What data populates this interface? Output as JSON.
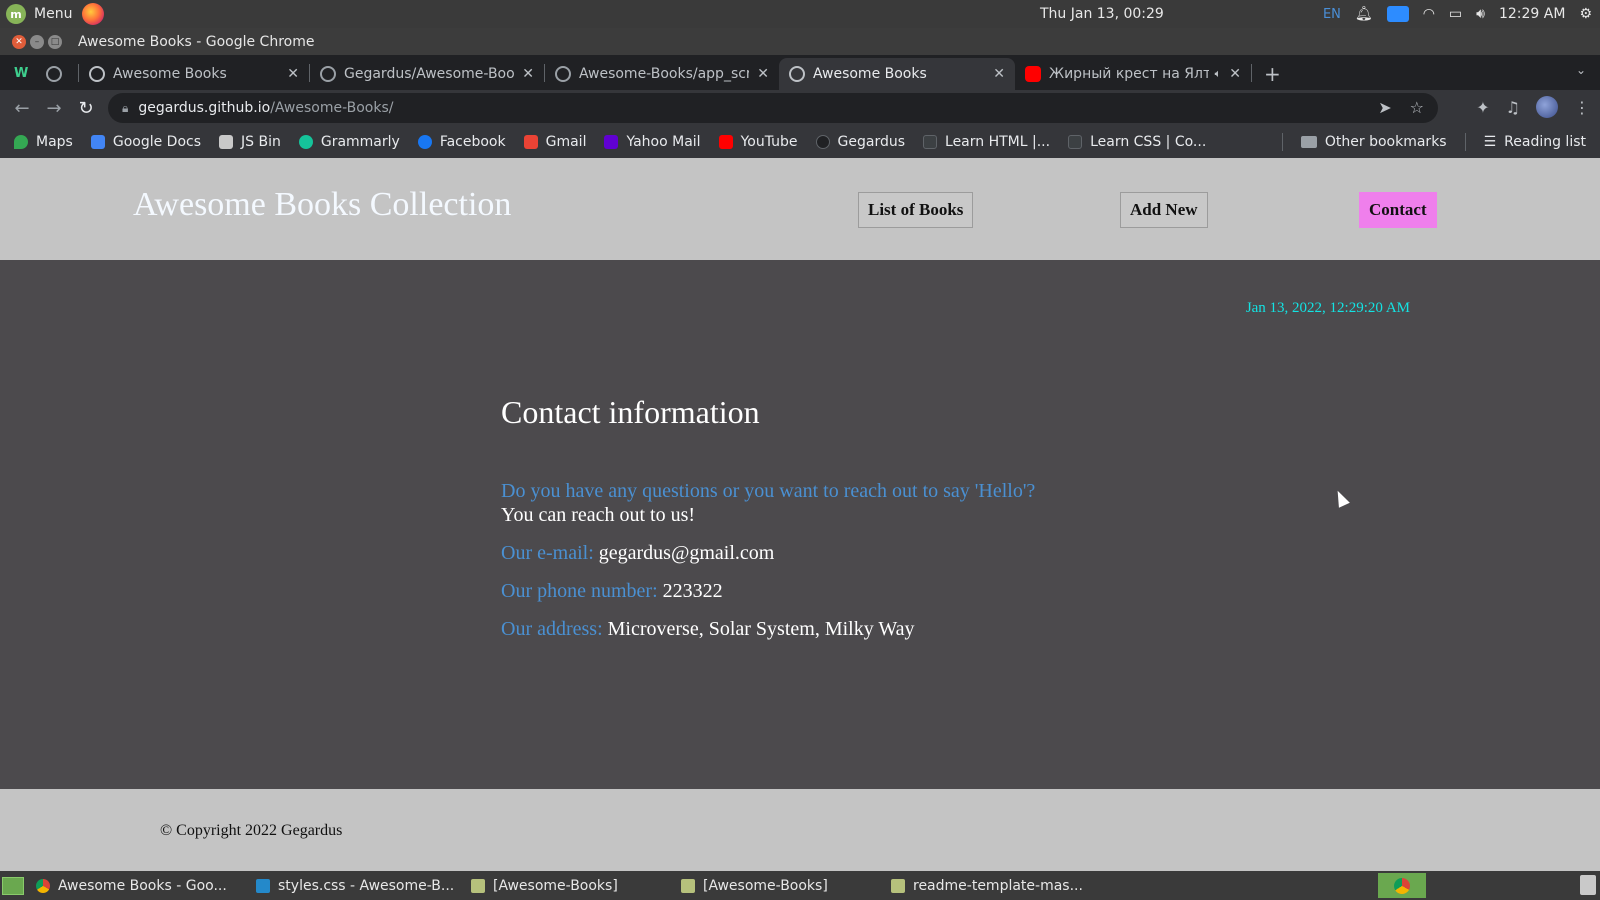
{
  "os": {
    "menu_label": "Menu",
    "clock_datetime": "Thu Jan 13, 00:29",
    "keyboard_layout": "EN",
    "tray_time": "12:29 AM"
  },
  "window": {
    "title": "Awesome Books - Google Chrome"
  },
  "browser": {
    "tabs": [
      {
        "label": "",
        "icon": "wix-icon",
        "active": false
      },
      {
        "label": "",
        "icon": "github-icon",
        "active": false
      },
      {
        "label": "Awesome Books",
        "icon": "globe-icon",
        "active": false
      },
      {
        "label": "Gegardus/Awesome-Boo",
        "icon": "github-icon",
        "active": false
      },
      {
        "label": "Awesome-Books/app_scr",
        "icon": "github-icon",
        "active": false
      },
      {
        "label": "Awesome Books",
        "icon": "globe-icon",
        "active": true
      },
      {
        "label": "Жирный крест на Ялт",
        "icon": "youtube-icon",
        "active": false
      }
    ],
    "url_host": "gegardus.github.io",
    "url_path": "/Awesome-Books/",
    "bookmarks": [
      {
        "label": "Maps",
        "color": "#34a853"
      },
      {
        "label": "Google Docs",
        "color": "#4285f4"
      },
      {
        "label": "JS Bin",
        "color": "#c9c9c9"
      },
      {
        "label": "Grammarly",
        "color": "#15c39a"
      },
      {
        "label": "Facebook",
        "color": "#1877f2"
      },
      {
        "label": "Gmail",
        "color": "#ea4335"
      },
      {
        "label": "Yahoo Mail",
        "color": "#6001d2"
      },
      {
        "label": "YouTube",
        "color": "#ff0000"
      },
      {
        "label": "Gegardus",
        "color": "#202124"
      },
      {
        "label": "Learn HTML |...",
        "color": "#3c4043"
      },
      {
        "label": "Learn CSS | Co...",
        "color": "#3c4043"
      }
    ],
    "other_bookmarks": "Other bookmarks",
    "reading_list": "Reading list"
  },
  "site": {
    "brand": "Awesome Books Collection",
    "nav": {
      "list": "List of Books",
      "add": "Add New",
      "contact": "Contact"
    },
    "datetime": "Jan 13, 2022, 12:29:20 AM",
    "contact": {
      "heading": "Contact information",
      "question": "Do you have any questions or you want to reach out to say 'Hello'?",
      "reach": "You can reach out to us!",
      "email_label": "Our e-mail:",
      "email_value": "gegardus@gmail.com",
      "phone_label": "Our phone number:",
      "phone_value": "223322",
      "address_label": "Our address:",
      "address_value": "Microverse, Solar System, Milky Way"
    },
    "copyright": "© Copyright 2022 Gegardus",
    "colors": {
      "accent_pink": "#ef7fec",
      "date_cyan": "#13e3e3",
      "label_blue": "#4a90d2"
    }
  },
  "taskbar": {
    "tasks": [
      {
        "label": "Awesome Books - Goo...",
        "icon": "chrome-icon"
      },
      {
        "label": "styles.css - Awesome-B...",
        "icon": "vscode-icon"
      },
      {
        "label": "[Awesome-Books]",
        "icon": "folder-icon"
      },
      {
        "label": "[Awesome-Books]",
        "icon": "folder-icon"
      },
      {
        "label": "readme-template-mas...",
        "icon": "folder-icon"
      }
    ]
  }
}
